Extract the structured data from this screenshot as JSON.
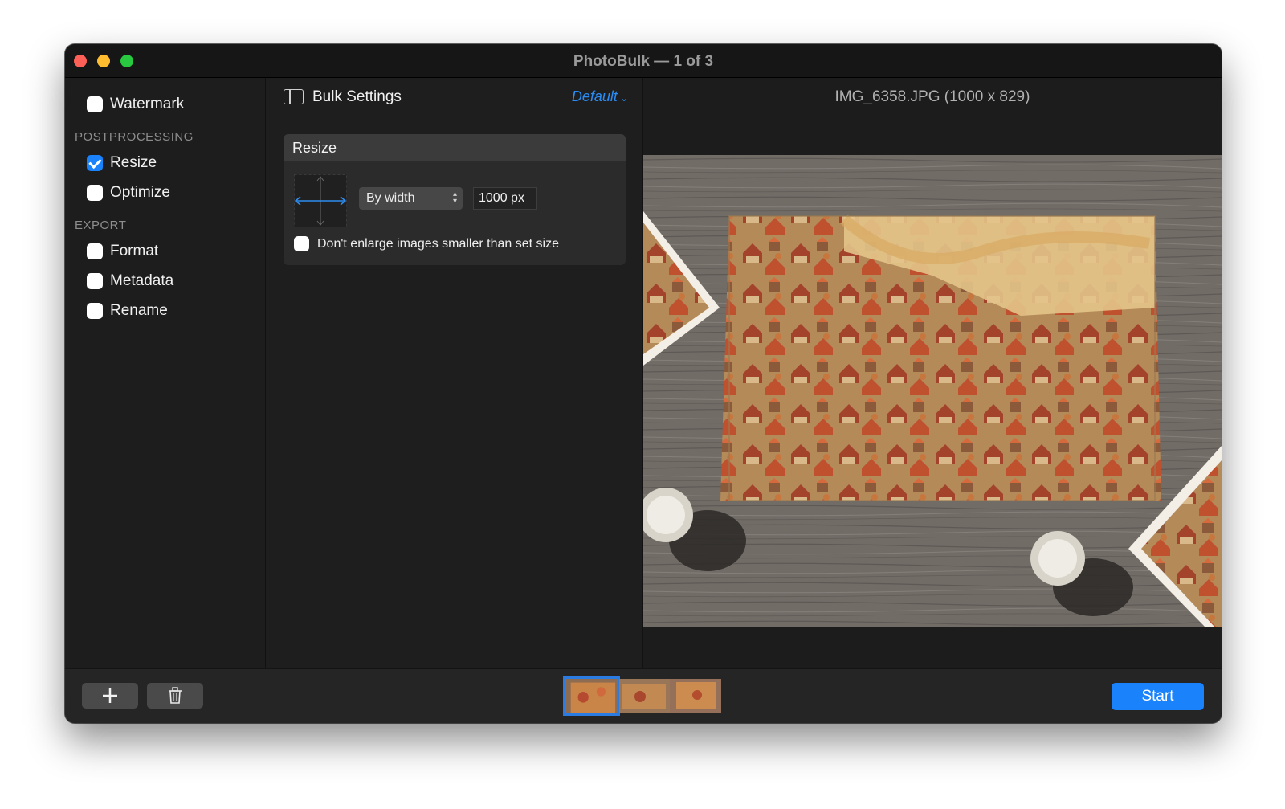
{
  "window": {
    "title": "PhotoBulk — 1 of 3"
  },
  "sidebar": {
    "watermark": {
      "label": "Watermark",
      "checked": false
    },
    "postprocessing": {
      "heading": "POSTPROCESSING",
      "items": [
        {
          "label": "Resize",
          "checked": true
        },
        {
          "label": "Optimize",
          "checked": false
        }
      ]
    },
    "export": {
      "heading": "EXPORT",
      "items": [
        {
          "label": "Format",
          "checked": false
        },
        {
          "label": "Metadata",
          "checked": false
        },
        {
          "label": "Rename",
          "checked": false
        }
      ]
    }
  },
  "settings": {
    "title": "Bulk Settings",
    "preset": "Default",
    "resize_card": {
      "title": "Resize",
      "mode": "By width",
      "value": "1000 px",
      "dont_enlarge": {
        "label": "Don't enlarge images smaller than set size",
        "checked": false
      }
    }
  },
  "preview": {
    "image_label": "IMG_6358.JPG (1000 x 829)"
  },
  "bottom": {
    "thumbnail_count": 3,
    "selected_thumbnail": 1,
    "start_label": "Start"
  },
  "colors": {
    "accent": "#1a82fb",
    "preset_link": "#2a8cf5",
    "window_bg": "#1e1e1e"
  },
  "icons": [
    "panel-icon",
    "chevron-down-icon",
    "resize-arrows-icon",
    "updown-arrows-icon",
    "plus-icon",
    "trash-icon"
  ]
}
